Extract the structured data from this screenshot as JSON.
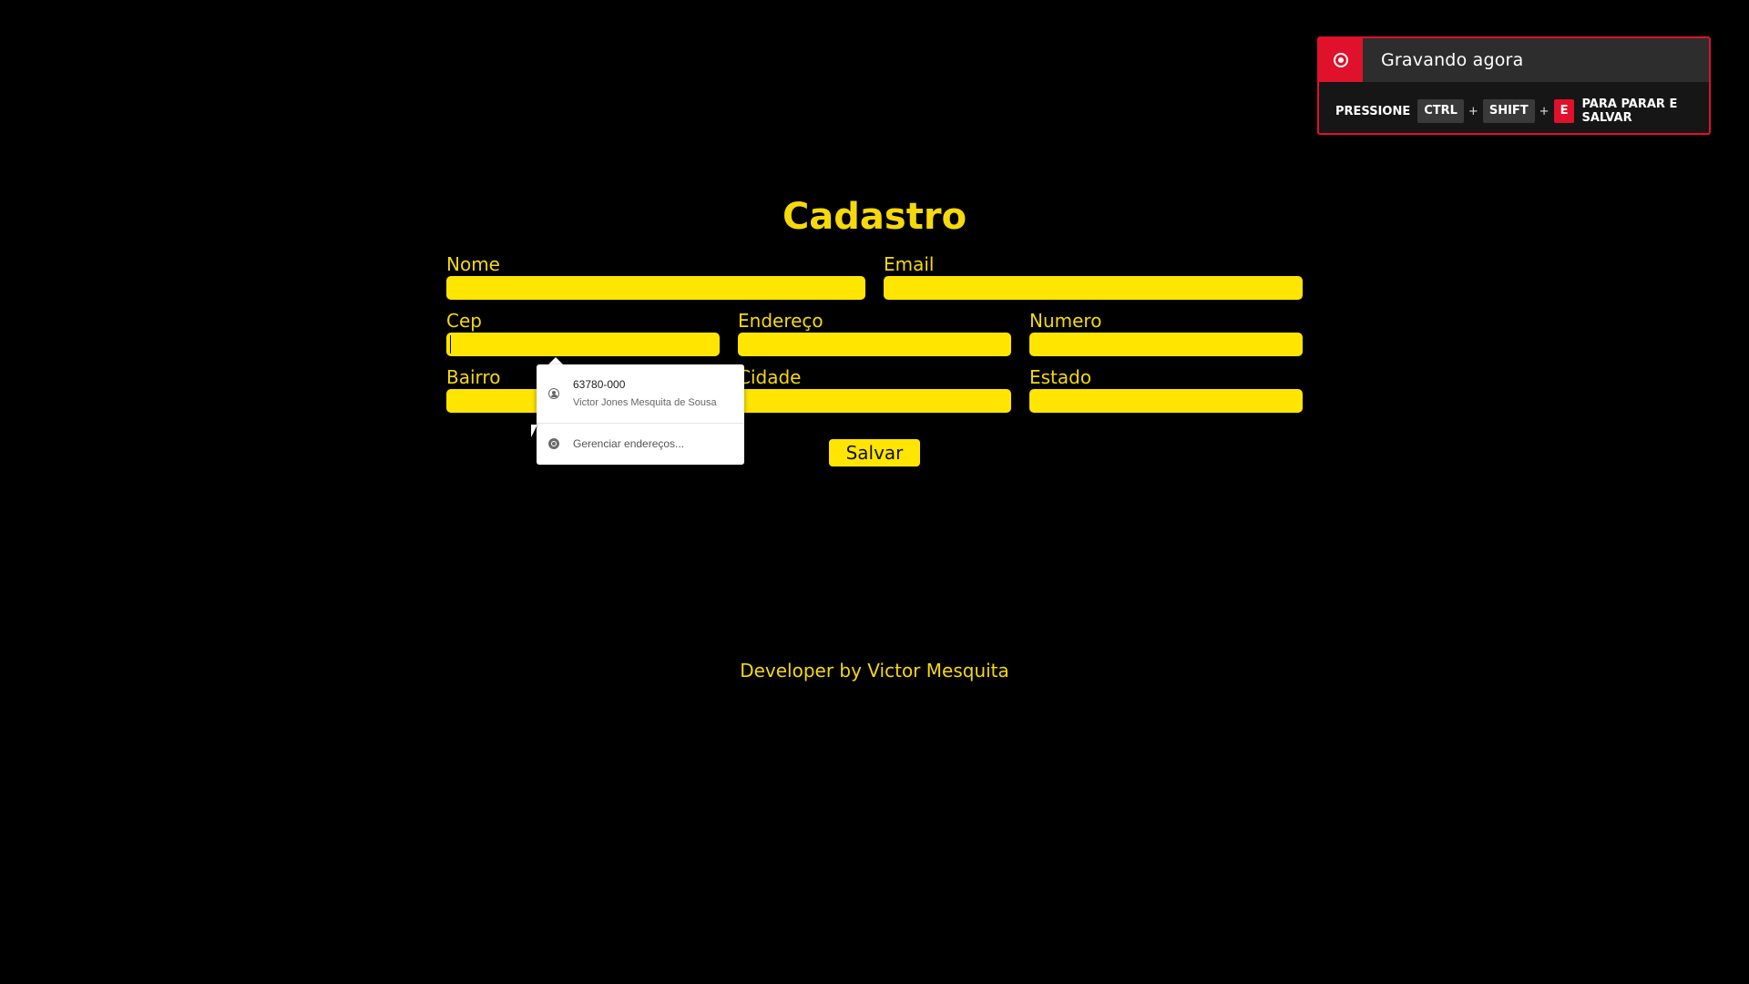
{
  "recording": {
    "title": "Gravando agora",
    "press_label": "PRESSIONE",
    "keys": [
      "CTRL",
      "SHIFT",
      "E"
    ],
    "plus": "+",
    "action_label": "PARA PARAR E SALVAR",
    "accent_color": "#e0112b"
  },
  "form": {
    "title": "Cadastro",
    "fields": {
      "nome": {
        "label": "Nome",
        "value": ""
      },
      "email": {
        "label": "Email",
        "value": ""
      },
      "cep": {
        "label": "Cep",
        "value": ""
      },
      "endereco": {
        "label": "Endereço",
        "value": ""
      },
      "numero": {
        "label": "Numero",
        "value": ""
      },
      "bairro": {
        "label": "Bairro",
        "value": ""
      },
      "cidade": {
        "label": "Cidade",
        "value": ""
      },
      "estado": {
        "label": "Estado",
        "value": ""
      }
    },
    "save_label": "Salvar",
    "accent_color": "#ffe500"
  },
  "autocomplete": {
    "items": [
      {
        "main": "63780-000",
        "sub": "Victor Jones Mesquita de Sousa",
        "icon": "person-icon"
      }
    ],
    "manage_label": "Gerenciar endereços...",
    "manage_icon": "chrome-icon"
  },
  "footer": {
    "text": "Developer by Victor Mesquita"
  }
}
